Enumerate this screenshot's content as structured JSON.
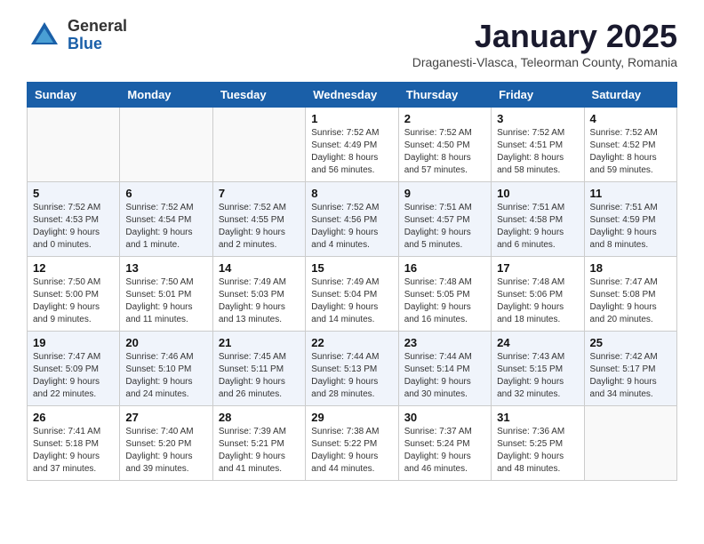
{
  "logo": {
    "general": "General",
    "blue": "Blue"
  },
  "header": {
    "month": "January 2025",
    "subtitle": "Draganesti-Vlasca, Teleorman County, Romania"
  },
  "weekdays": [
    "Sunday",
    "Monday",
    "Tuesday",
    "Wednesday",
    "Thursday",
    "Friday",
    "Saturday"
  ],
  "weeks": [
    [
      {
        "day": "",
        "info": ""
      },
      {
        "day": "",
        "info": ""
      },
      {
        "day": "",
        "info": ""
      },
      {
        "day": "1",
        "info": "Sunrise: 7:52 AM\nSunset: 4:49 PM\nDaylight: 8 hours\nand 56 minutes."
      },
      {
        "day": "2",
        "info": "Sunrise: 7:52 AM\nSunset: 4:50 PM\nDaylight: 8 hours\nand 57 minutes."
      },
      {
        "day": "3",
        "info": "Sunrise: 7:52 AM\nSunset: 4:51 PM\nDaylight: 8 hours\nand 58 minutes."
      },
      {
        "day": "4",
        "info": "Sunrise: 7:52 AM\nSunset: 4:52 PM\nDaylight: 8 hours\nand 59 minutes."
      }
    ],
    [
      {
        "day": "5",
        "info": "Sunrise: 7:52 AM\nSunset: 4:53 PM\nDaylight: 9 hours\nand 0 minutes."
      },
      {
        "day": "6",
        "info": "Sunrise: 7:52 AM\nSunset: 4:54 PM\nDaylight: 9 hours\nand 1 minute."
      },
      {
        "day": "7",
        "info": "Sunrise: 7:52 AM\nSunset: 4:55 PM\nDaylight: 9 hours\nand 2 minutes."
      },
      {
        "day": "8",
        "info": "Sunrise: 7:52 AM\nSunset: 4:56 PM\nDaylight: 9 hours\nand 4 minutes."
      },
      {
        "day": "9",
        "info": "Sunrise: 7:51 AM\nSunset: 4:57 PM\nDaylight: 9 hours\nand 5 minutes."
      },
      {
        "day": "10",
        "info": "Sunrise: 7:51 AM\nSunset: 4:58 PM\nDaylight: 9 hours\nand 6 minutes."
      },
      {
        "day": "11",
        "info": "Sunrise: 7:51 AM\nSunset: 4:59 PM\nDaylight: 9 hours\nand 8 minutes."
      }
    ],
    [
      {
        "day": "12",
        "info": "Sunrise: 7:50 AM\nSunset: 5:00 PM\nDaylight: 9 hours\nand 9 minutes."
      },
      {
        "day": "13",
        "info": "Sunrise: 7:50 AM\nSunset: 5:01 PM\nDaylight: 9 hours\nand 11 minutes."
      },
      {
        "day": "14",
        "info": "Sunrise: 7:49 AM\nSunset: 5:03 PM\nDaylight: 9 hours\nand 13 minutes."
      },
      {
        "day": "15",
        "info": "Sunrise: 7:49 AM\nSunset: 5:04 PM\nDaylight: 9 hours\nand 14 minutes."
      },
      {
        "day": "16",
        "info": "Sunrise: 7:48 AM\nSunset: 5:05 PM\nDaylight: 9 hours\nand 16 minutes."
      },
      {
        "day": "17",
        "info": "Sunrise: 7:48 AM\nSunset: 5:06 PM\nDaylight: 9 hours\nand 18 minutes."
      },
      {
        "day": "18",
        "info": "Sunrise: 7:47 AM\nSunset: 5:08 PM\nDaylight: 9 hours\nand 20 minutes."
      }
    ],
    [
      {
        "day": "19",
        "info": "Sunrise: 7:47 AM\nSunset: 5:09 PM\nDaylight: 9 hours\nand 22 minutes."
      },
      {
        "day": "20",
        "info": "Sunrise: 7:46 AM\nSunset: 5:10 PM\nDaylight: 9 hours\nand 24 minutes."
      },
      {
        "day": "21",
        "info": "Sunrise: 7:45 AM\nSunset: 5:11 PM\nDaylight: 9 hours\nand 26 minutes."
      },
      {
        "day": "22",
        "info": "Sunrise: 7:44 AM\nSunset: 5:13 PM\nDaylight: 9 hours\nand 28 minutes."
      },
      {
        "day": "23",
        "info": "Sunrise: 7:44 AM\nSunset: 5:14 PM\nDaylight: 9 hours\nand 30 minutes."
      },
      {
        "day": "24",
        "info": "Sunrise: 7:43 AM\nSunset: 5:15 PM\nDaylight: 9 hours\nand 32 minutes."
      },
      {
        "day": "25",
        "info": "Sunrise: 7:42 AM\nSunset: 5:17 PM\nDaylight: 9 hours\nand 34 minutes."
      }
    ],
    [
      {
        "day": "26",
        "info": "Sunrise: 7:41 AM\nSunset: 5:18 PM\nDaylight: 9 hours\nand 37 minutes."
      },
      {
        "day": "27",
        "info": "Sunrise: 7:40 AM\nSunset: 5:20 PM\nDaylight: 9 hours\nand 39 minutes."
      },
      {
        "day": "28",
        "info": "Sunrise: 7:39 AM\nSunset: 5:21 PM\nDaylight: 9 hours\nand 41 minutes."
      },
      {
        "day": "29",
        "info": "Sunrise: 7:38 AM\nSunset: 5:22 PM\nDaylight: 9 hours\nand 44 minutes."
      },
      {
        "day": "30",
        "info": "Sunrise: 7:37 AM\nSunset: 5:24 PM\nDaylight: 9 hours\nand 46 minutes."
      },
      {
        "day": "31",
        "info": "Sunrise: 7:36 AM\nSunset: 5:25 PM\nDaylight: 9 hours\nand 48 minutes."
      },
      {
        "day": "",
        "info": ""
      }
    ]
  ]
}
